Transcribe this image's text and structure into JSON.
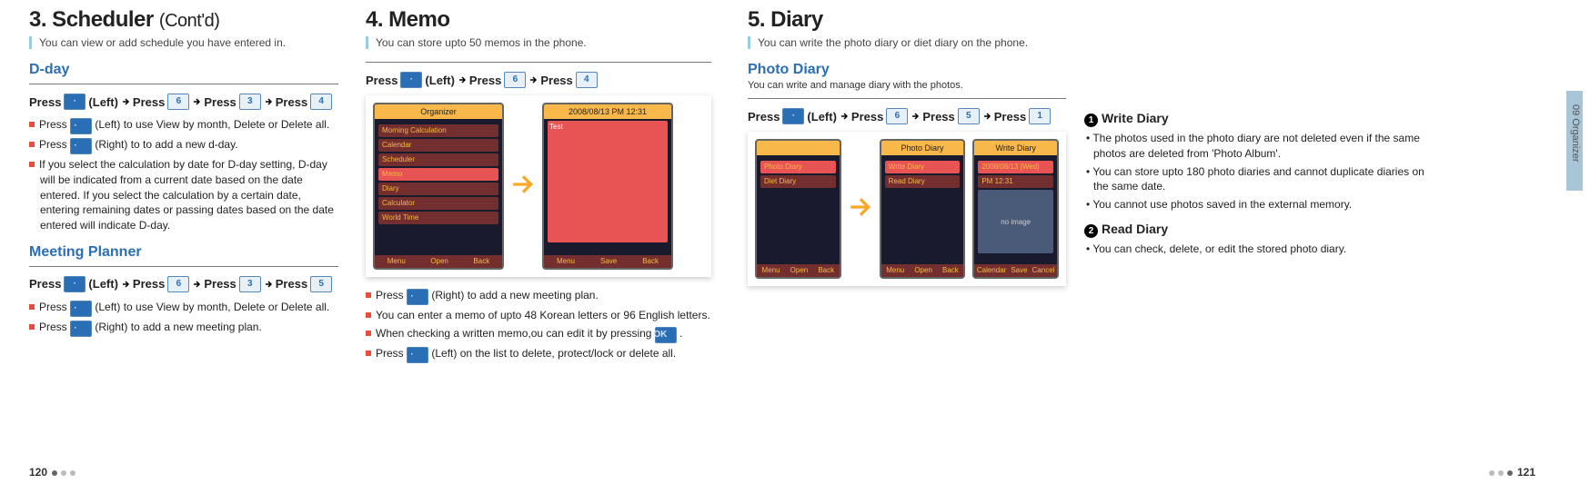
{
  "side_label": "09 Organizer",
  "footer": {
    "left": "120",
    "right": "121"
  },
  "col1": {
    "title": "3. Scheduler",
    "cont": "(Cont'd)",
    "intro": "You can view or add schedule you have entered in.",
    "dday": {
      "heading": "D-day",
      "press": [
        "Press",
        "soft",
        "(Left)",
        "arrow",
        "Press",
        "6",
        "arrow",
        "Press",
        "3",
        "arrow",
        "Press",
        "4"
      ],
      "bullets": [
        "Press [soft] (Left) to use View by month, Delete or Delete all.",
        "Press [soft] (Right) to to add a new d-day.",
        "If you select the calculation by date for D-day setting, D-day will be indicated from a current date based on the date entered. If you select the calculation by a certain date, entering remaining dates or passing dates based on the date entered will indicate D-day."
      ]
    },
    "meeting": {
      "heading": "Meeting Planner",
      "press": [
        "Press",
        "soft",
        "(Left)",
        "arrow",
        "Press",
        "6",
        "arrow",
        "Press",
        "3",
        "arrow",
        "Press",
        "5"
      ],
      "bullets": [
        "Press [soft] (Left) to use View by month, Delete or Delete all.",
        "Press [soft] (Right) to add a new meeting plan."
      ]
    }
  },
  "col2": {
    "title": "4. Memo",
    "intro": "You can store upto 50 memos in the phone.",
    "press": [
      "Press",
      "soft",
      "(Left)",
      "arrow",
      "Press",
      "6",
      "arrow",
      "Press",
      "4"
    ],
    "screens": {
      "left": {
        "header": "Organizer",
        "rows": [
          "Morning Calculation",
          "Calendar",
          "Scheduler",
          "Memo",
          "Diary",
          "Calculator",
          "World Time"
        ],
        "sel_index": 3,
        "foot": [
          "Menu",
          "Open",
          "Back"
        ]
      },
      "right": {
        "header": "2008/08/13 PM 12:31",
        "memo": "Test",
        "foot": [
          "Menu",
          "Save",
          "Back"
        ]
      }
    },
    "bullets": [
      "Press [soft] (Right) to add a new meeting plan.",
      "You can enter a memo of upto 48 Korean letters or 96 English letters.",
      "When checking a written memo,ou can edit it by pressing [ok] .",
      "Press [soft] (Left) on the list to delete, protect/lock or delete all."
    ]
  },
  "col3": {
    "title": "5. Diary",
    "intro": "You can write the photo diary or diet diary on the phone.",
    "photo": {
      "heading": "Photo Diary",
      "note": "You can write and manage diary with the photos.",
      "press": [
        "Press",
        "soft",
        "(Left)",
        "arrow",
        "Press",
        "6",
        "arrow",
        "Press",
        "5",
        "arrow",
        "Press",
        "1"
      ]
    },
    "screens": {
      "s1": {
        "header": "",
        "rows": [
          "Photo Diary",
          "Diet Diary"
        ],
        "sel_index": 0,
        "foot": [
          "Menu",
          "Open",
          "Back"
        ]
      },
      "s2": {
        "header": "Photo Diary",
        "rows": [
          "Write Diary",
          "Read Diary"
        ],
        "sel_index": 0,
        "foot": [
          "Menu",
          "Open",
          "Back"
        ]
      },
      "s3": {
        "header": "Write Diary",
        "date": "2008/08/13 [Wed]",
        "time": "PM 12:31",
        "noimg": "no image",
        "foot": [
          "Calendar",
          "Save",
          "Cancel"
        ]
      }
    }
  },
  "col4": {
    "write": {
      "num": "1",
      "heading": "Write Diary",
      "bullets": [
        "The photos used in the photo diary are not deleted even if the same photos are deleted from 'Photo Album'.",
        "You can store upto 180 photo diaries and cannot duplicate diaries on the same date.",
        "You cannot use photos saved in the external memory."
      ]
    },
    "read": {
      "num": "2",
      "heading": "Read Diary",
      "bullets": [
        "You can check, delete, or edit the stored photo diary."
      ]
    }
  }
}
